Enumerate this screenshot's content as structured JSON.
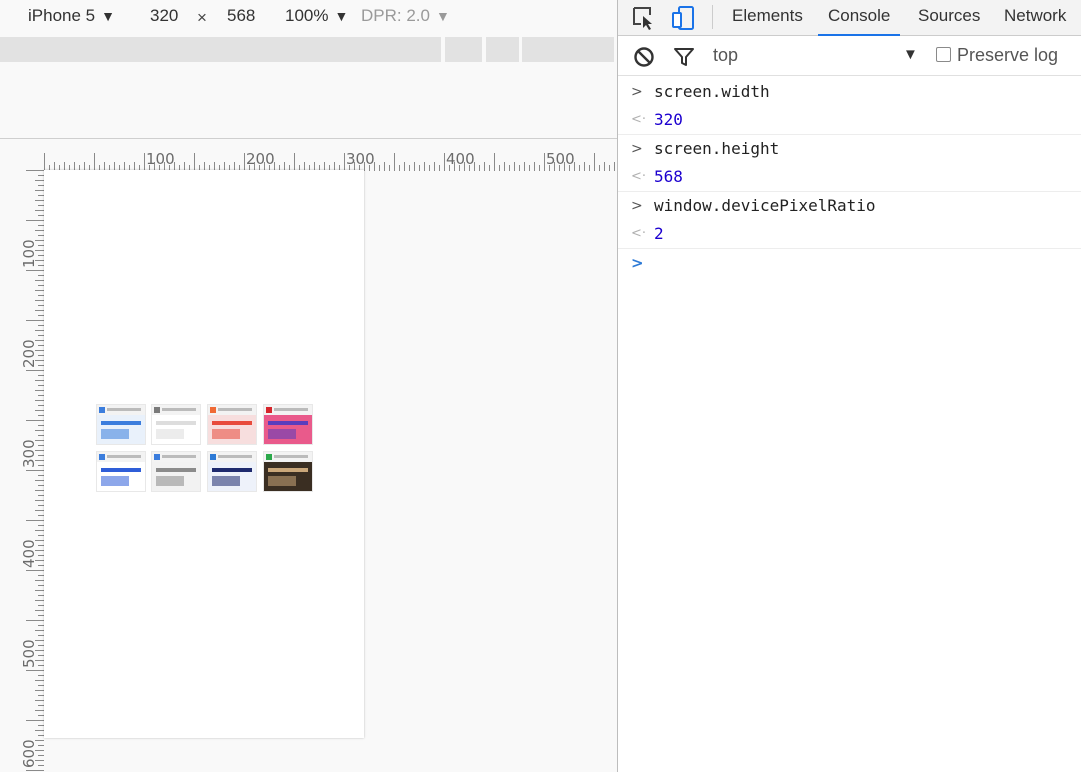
{
  "device_toolbar": {
    "device": "iPhone 5",
    "width": "320",
    "times": "×",
    "height": "568",
    "zoom": "100%",
    "dpr": "DPR: 2.0",
    "arrow": "▼"
  },
  "rulers": {
    "horizontal_labels": [
      "100",
      "200",
      "300",
      "400",
      "500"
    ],
    "vertical_labels": [
      "100",
      "200",
      "300",
      "400",
      "500",
      "600"
    ]
  },
  "thumbnails": [
    {
      "fav": "#3b7ddd",
      "body": "#e9f1fb",
      "accent": "#3b7ddd"
    },
    {
      "fav": "#7a7a7a",
      "body": "#ffffff",
      "accent": "#dddddd"
    },
    {
      "fav": "#f06a35",
      "body": "#f7dede",
      "accent": "#e84b3c"
    },
    {
      "fav": "#d6262d",
      "body": "#e95a8b",
      "accent": "#5a3dbd"
    },
    {
      "fav": "#3b7ddd",
      "body": "#ffffff",
      "accent": "#2f5ed8"
    },
    {
      "fav": "#3b7ddd",
      "body": "#f2f2f2",
      "accent": "#8b8b8b"
    },
    {
      "fav": "#2d7ad6",
      "body": "#eef2fa",
      "accent": "#1e2a6e"
    },
    {
      "fav": "#2ba84a",
      "body": "#3a2e22",
      "accent": "#caa77a"
    }
  ],
  "devtools": {
    "tabs": [
      {
        "label": "Elements",
        "active": false
      },
      {
        "label": "Console",
        "active": true
      },
      {
        "label": "Sources",
        "active": false
      },
      {
        "label": "Network",
        "active": false
      }
    ],
    "context": "top",
    "context_arrow": "▼",
    "preserve_log": "Preserve log",
    "accent": "#1a73e8"
  },
  "console": {
    "lines": [
      {
        "kind": "command",
        "gutter": ">",
        "text": "screen.width"
      },
      {
        "kind": "result",
        "gutter": "<·",
        "text": "320"
      },
      {
        "kind": "command",
        "gutter": ">",
        "text": "screen.height"
      },
      {
        "kind": "result",
        "gutter": "<·",
        "text": "568"
      },
      {
        "kind": "command",
        "gutter": ">",
        "text": "window.devicePixelRatio"
      },
      {
        "kind": "result",
        "gutter": "<·",
        "text": "2"
      }
    ],
    "prompt": ">",
    "result_color": "#1c00cf"
  }
}
